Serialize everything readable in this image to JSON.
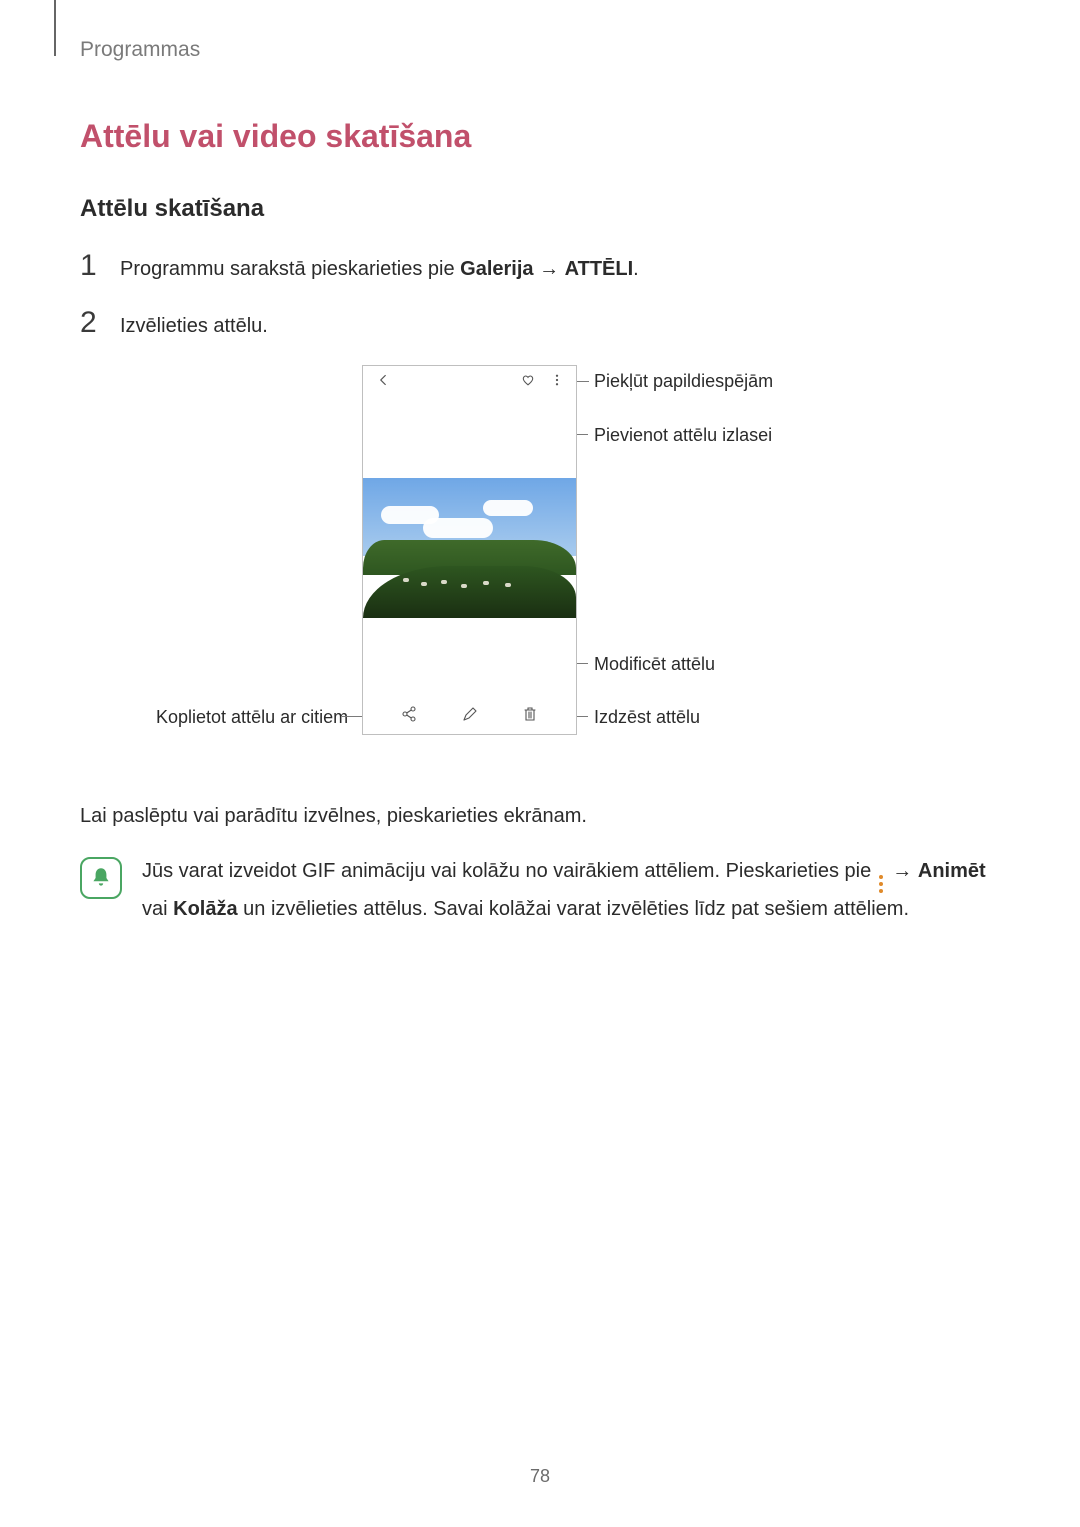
{
  "header": "Programmas",
  "h1": "Attēlu vai video skatīšana",
  "h2": "Attēlu skatīšana",
  "steps": [
    {
      "prefix": "Programmu sarakstā pieskarieties pie ",
      "bold1": "Galerija",
      "arrow": " → ",
      "bold2": "ATTĒLI",
      "suffix": "."
    },
    {
      "text": "Izvēlieties attēlu."
    }
  ],
  "callouts": {
    "more": "Piekļūt papildiespējām",
    "heart": "Pievienot attēlu izlasei",
    "edit": "Modificēt attēlu",
    "delete": "Izdzēst attēlu",
    "share": "Koplietot attēlu ar citiem"
  },
  "para": "Lai paslēptu vai parādītu izvēlnes, pieskarieties ekrānam.",
  "note": {
    "t1": "Jūs varat izveidot GIF animāciju vai kolāžu no vairākiem attēliem. Pieskarieties pie ",
    "arrow": " → ",
    "b1": "Animēt",
    "mid": " vai ",
    "b2": "Kolāža",
    "t2": " un izvēlieties attēlus. Savai kolāžai varat izvēlēties līdz pat sešiem attēliem."
  },
  "page": "78"
}
